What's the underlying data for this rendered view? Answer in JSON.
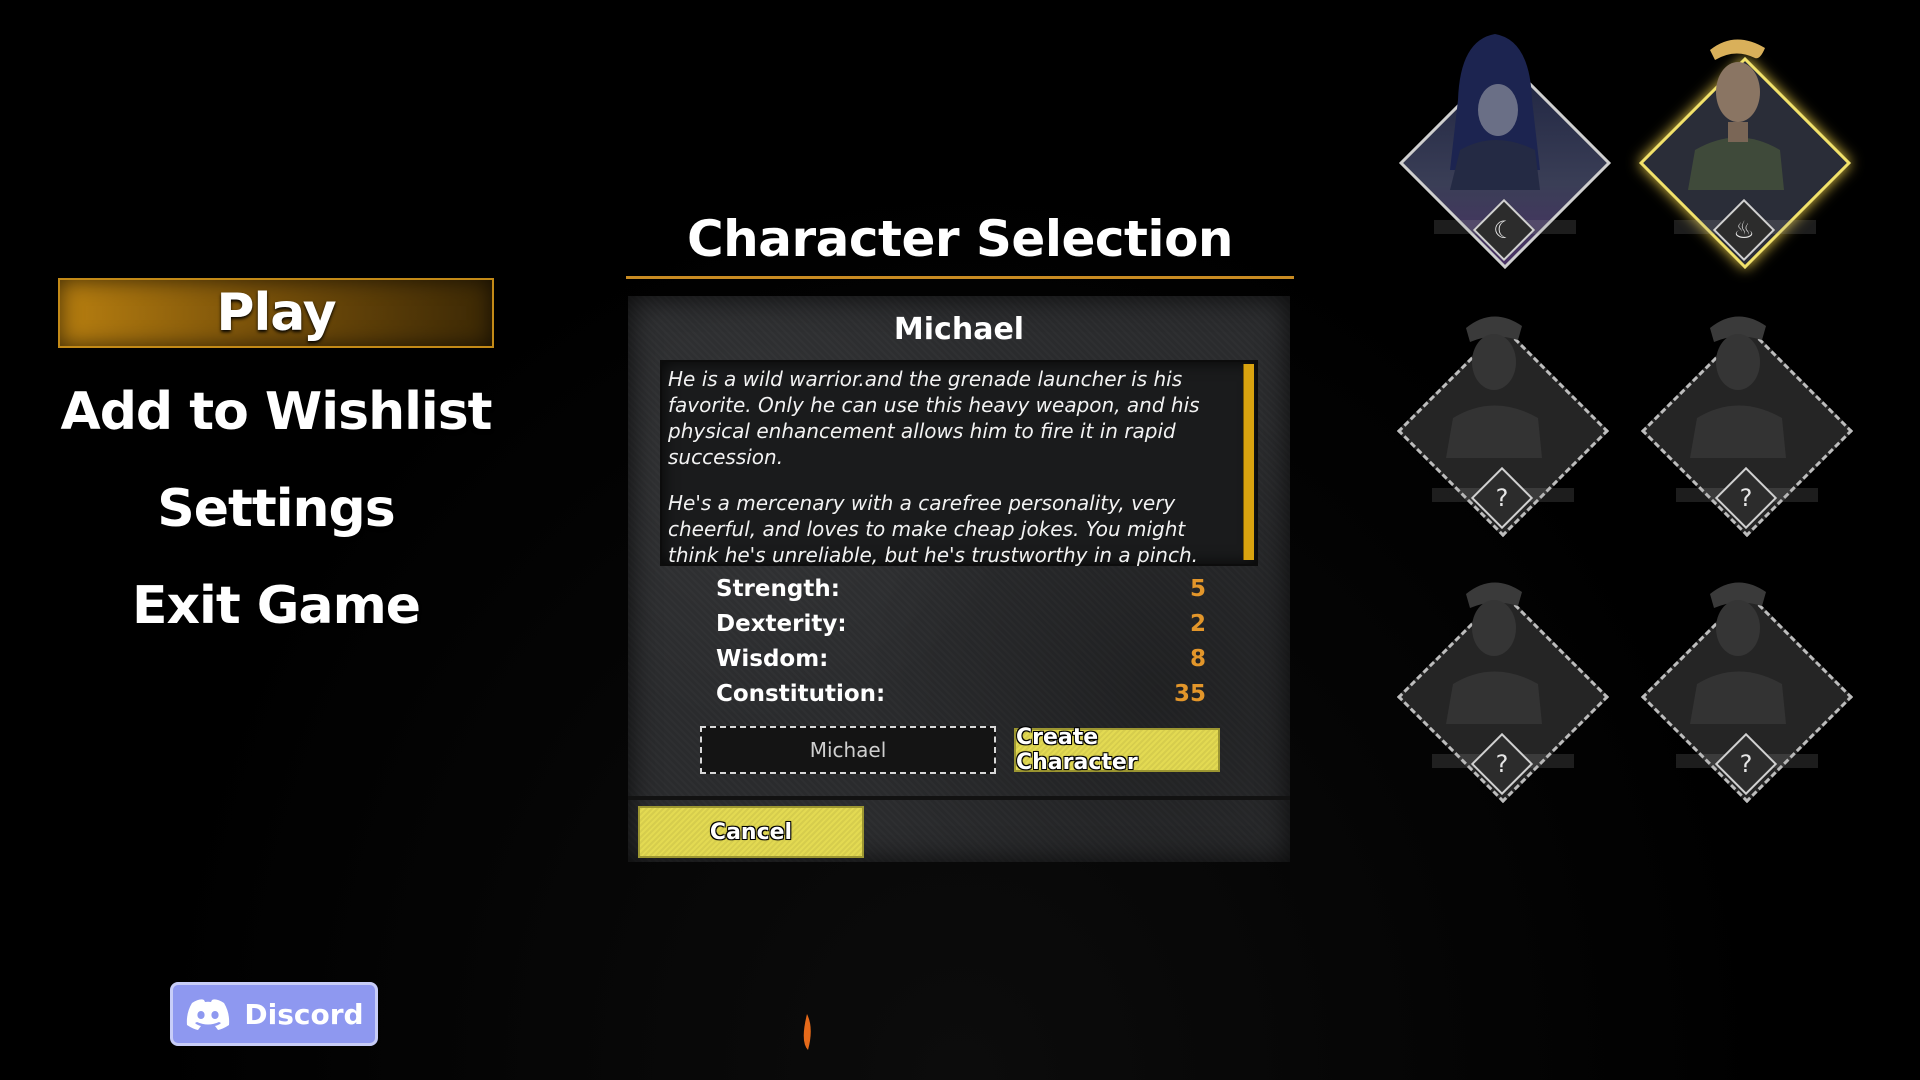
{
  "menu": {
    "items": [
      {
        "label": "Play",
        "active": true
      },
      {
        "label": "Add to Wishlist",
        "active": false
      },
      {
        "label": "Settings",
        "active": false
      },
      {
        "label": "Exit Game",
        "active": false
      }
    ]
  },
  "discord": {
    "label": "Discord",
    "icon": "discord-icon",
    "color": "#8e98f0"
  },
  "character_selection": {
    "title": "Character Selection",
    "selected_character": "Michael",
    "description": [
      "He is a wild warrior.and the grenade launcher is his favorite. Only he can use this heavy weapon, and his physical enhancement allows him to fire it in rapid succession.",
      "He's a mercenary with a carefree personality, very cheerful, and loves to make cheap jokes. You might think he's unreliable, but he's trustworthy in a pinch."
    ],
    "stats": [
      {
        "label": "Strength:",
        "value": "5"
      },
      {
        "label": "Dexterity:",
        "value": "2"
      },
      {
        "label": "Wisdom:",
        "value": "8"
      },
      {
        "label": "Constitution:",
        "value": "35"
      }
    ],
    "name_input": {
      "value": "Michael"
    },
    "create_label": "Create Character",
    "cancel_label": "Cancel"
  },
  "portraits": [
    {
      "name": "hooded-character",
      "state": "unlocked",
      "badge": "crescent-icon"
    },
    {
      "name": "michael",
      "state": "selected",
      "badge": "flame-icon"
    },
    {
      "name": "locked-1",
      "state": "locked",
      "badge": "?"
    },
    {
      "name": "locked-2",
      "state": "locked",
      "badge": "?"
    },
    {
      "name": "locked-3",
      "state": "locked",
      "badge": "?"
    },
    {
      "name": "locked-4",
      "state": "locked",
      "badge": "?"
    }
  ],
  "colors": {
    "accent": "#c98b22",
    "stat": "#e3962a",
    "button": "#e3da52",
    "selected_glow": "#f2e26a"
  }
}
